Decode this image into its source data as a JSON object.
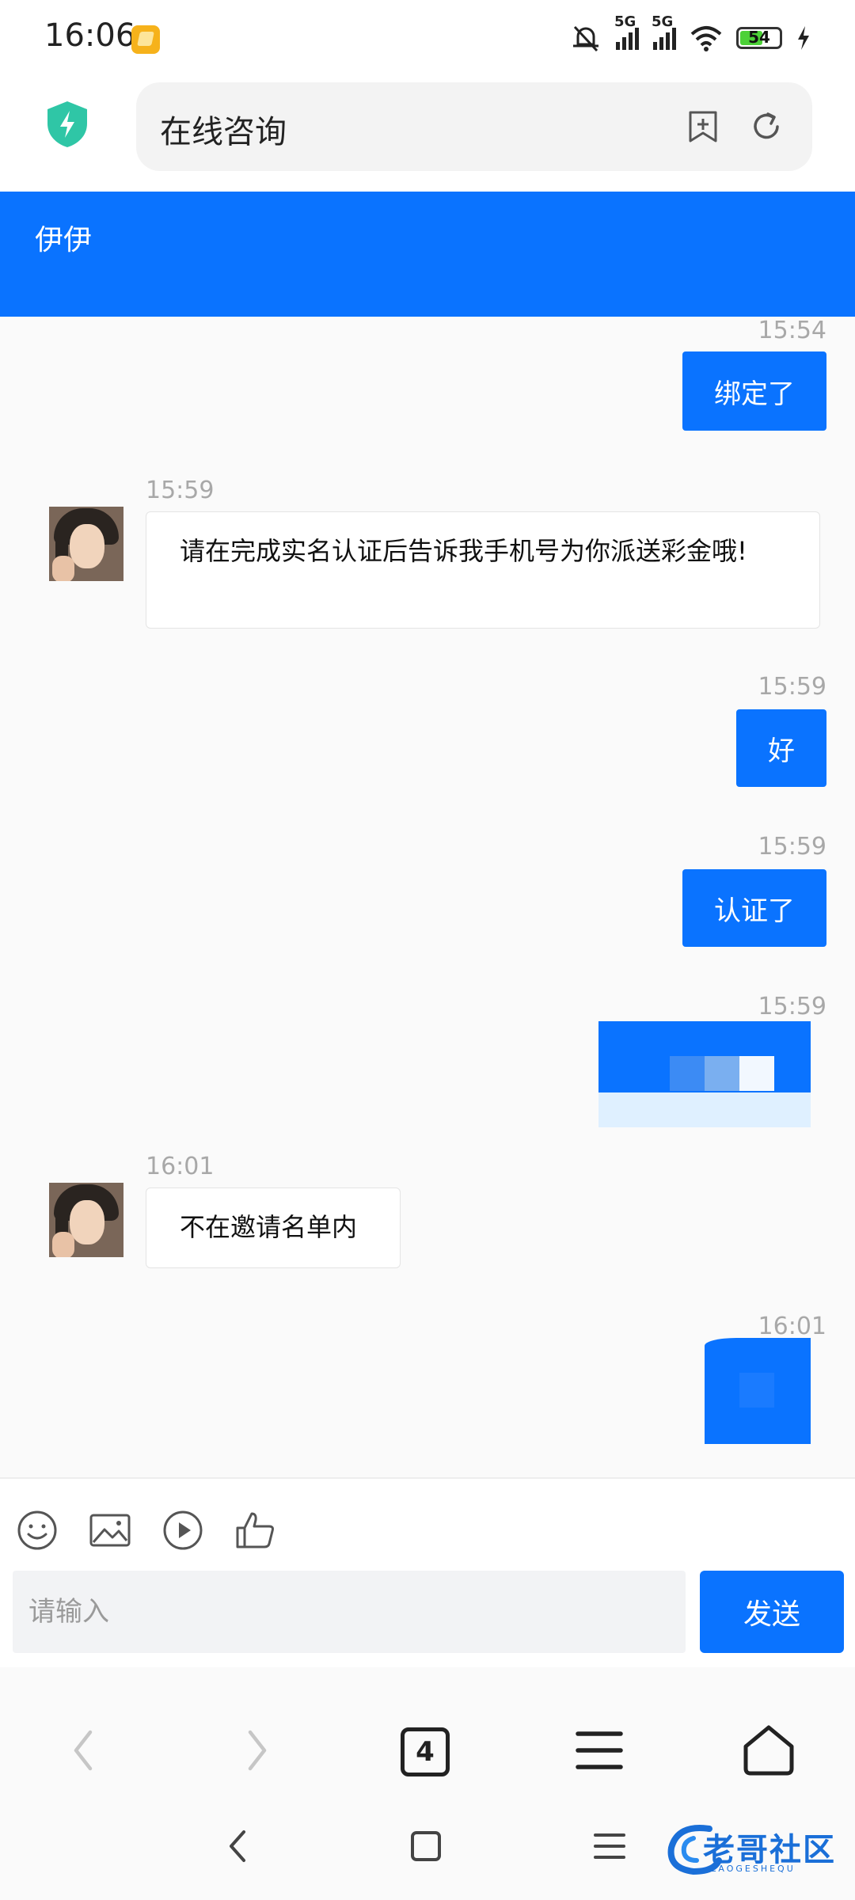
{
  "status_bar": {
    "time": "16:06",
    "network1": "5G",
    "network2": "5G",
    "battery": "54"
  },
  "browser": {
    "page_title": "在线咨询",
    "tab_count": "4"
  },
  "chat": {
    "contact_name": "伊伊",
    "messages": [
      {
        "side": "right",
        "time": "15:54",
        "text": "绑定了"
      },
      {
        "side": "left",
        "time": "15:59",
        "text": "请在完成实名认证后告诉我手机号为你派送彩金哦!"
      },
      {
        "side": "right",
        "time": "15:59",
        "text": "好"
      },
      {
        "side": "right",
        "time": "15:59",
        "text": "认证了"
      },
      {
        "side": "right",
        "time": "15:59",
        "type": "image"
      },
      {
        "side": "left",
        "time": "16:01",
        "text": "不在邀请名单内"
      },
      {
        "side": "right",
        "time": "16:01",
        "type": "image"
      }
    ]
  },
  "composer": {
    "placeholder": "请输入",
    "send_label": "发送"
  },
  "watermark": {
    "text": "老哥社区",
    "subtext": "LAOGESHEQU"
  },
  "colors": {
    "accent": "#0a73ff",
    "background": "#fafafa"
  }
}
